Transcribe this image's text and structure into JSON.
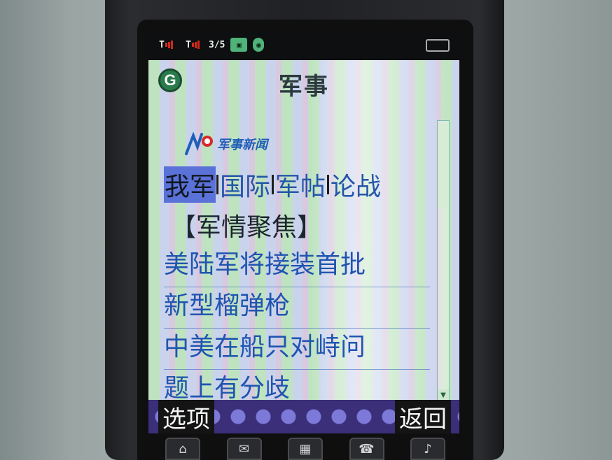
{
  "status_bar": {
    "icons": [
      "signal-1-icon",
      "signal-2-icon",
      "data-icon",
      "network-box-icon",
      "app-icon",
      "battery-icon"
    ],
    "signal1_text": "T",
    "signal2_text": "T",
    "data_text": "3/5"
  },
  "header": {
    "logo_letter": "G",
    "title": "军事"
  },
  "brand": {
    "text": "军事新闻"
  },
  "tabs": [
    {
      "label": "我军",
      "active": true
    },
    {
      "label": "国际",
      "active": false
    },
    {
      "label": "军帖",
      "active": false
    },
    {
      "label": "论战",
      "active": false
    }
  ],
  "section": {
    "heading": "【军情聚焦】"
  },
  "news": {
    "lines": [
      "美陆军将接装首批",
      "新型榴弹枪",
      "中美在船只对峙问",
      "题上有分歧"
    ]
  },
  "softkeys": {
    "left": "选项",
    "right": "返回"
  },
  "hardkeys": [
    "home-icon",
    "mail-icon",
    "keypad-icon",
    "phone-icon",
    "music-icon"
  ],
  "colors": {
    "link": "#1f55b0",
    "active_tab": "#5a71d8",
    "status_bar": "#0e0f10"
  }
}
